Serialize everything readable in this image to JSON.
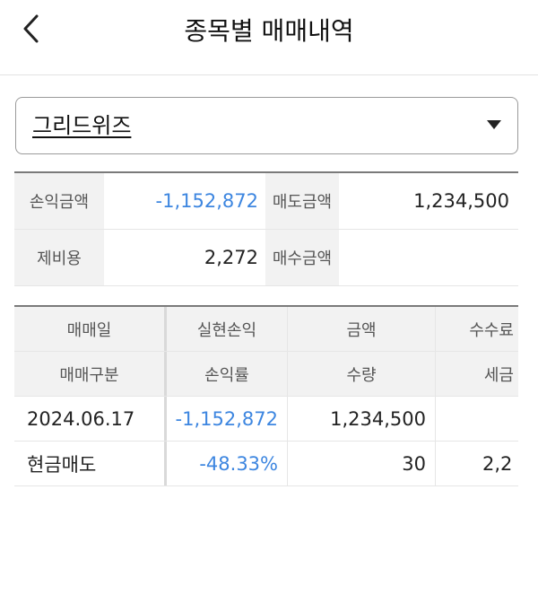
{
  "header": {
    "title": "종목별 매매내역",
    "back_icon": "chevron-left-icon"
  },
  "stock_select": {
    "value": "그리드위즈",
    "arrow_icon": "caret-down-icon"
  },
  "summary": {
    "profit_label": "손익금액",
    "profit_value": "-1,152,872",
    "sell_label": "매도금액",
    "sell_value": "1,234,500",
    "cost_label": "제비용",
    "cost_value": "2,272",
    "buy_label": "매수금액",
    "buy_value": ""
  },
  "table": {
    "headers_row1": [
      "매매일",
      "실현손익",
      "금액",
      "수수료"
    ],
    "headers_row2": [
      "매매구분",
      "손익률",
      "수량",
      "세금"
    ],
    "rows": [
      {
        "date": "2024.06.17",
        "realized": "-1,152,872",
        "amount": "1,234,500",
        "fee": ""
      },
      {
        "type": "현금매도",
        "rate": "-48.33%",
        "qty": "30",
        "tax": "2,2"
      }
    ]
  },
  "colors": {
    "negative": "#3d86e0",
    "label_bg": "#f2f2f2"
  }
}
